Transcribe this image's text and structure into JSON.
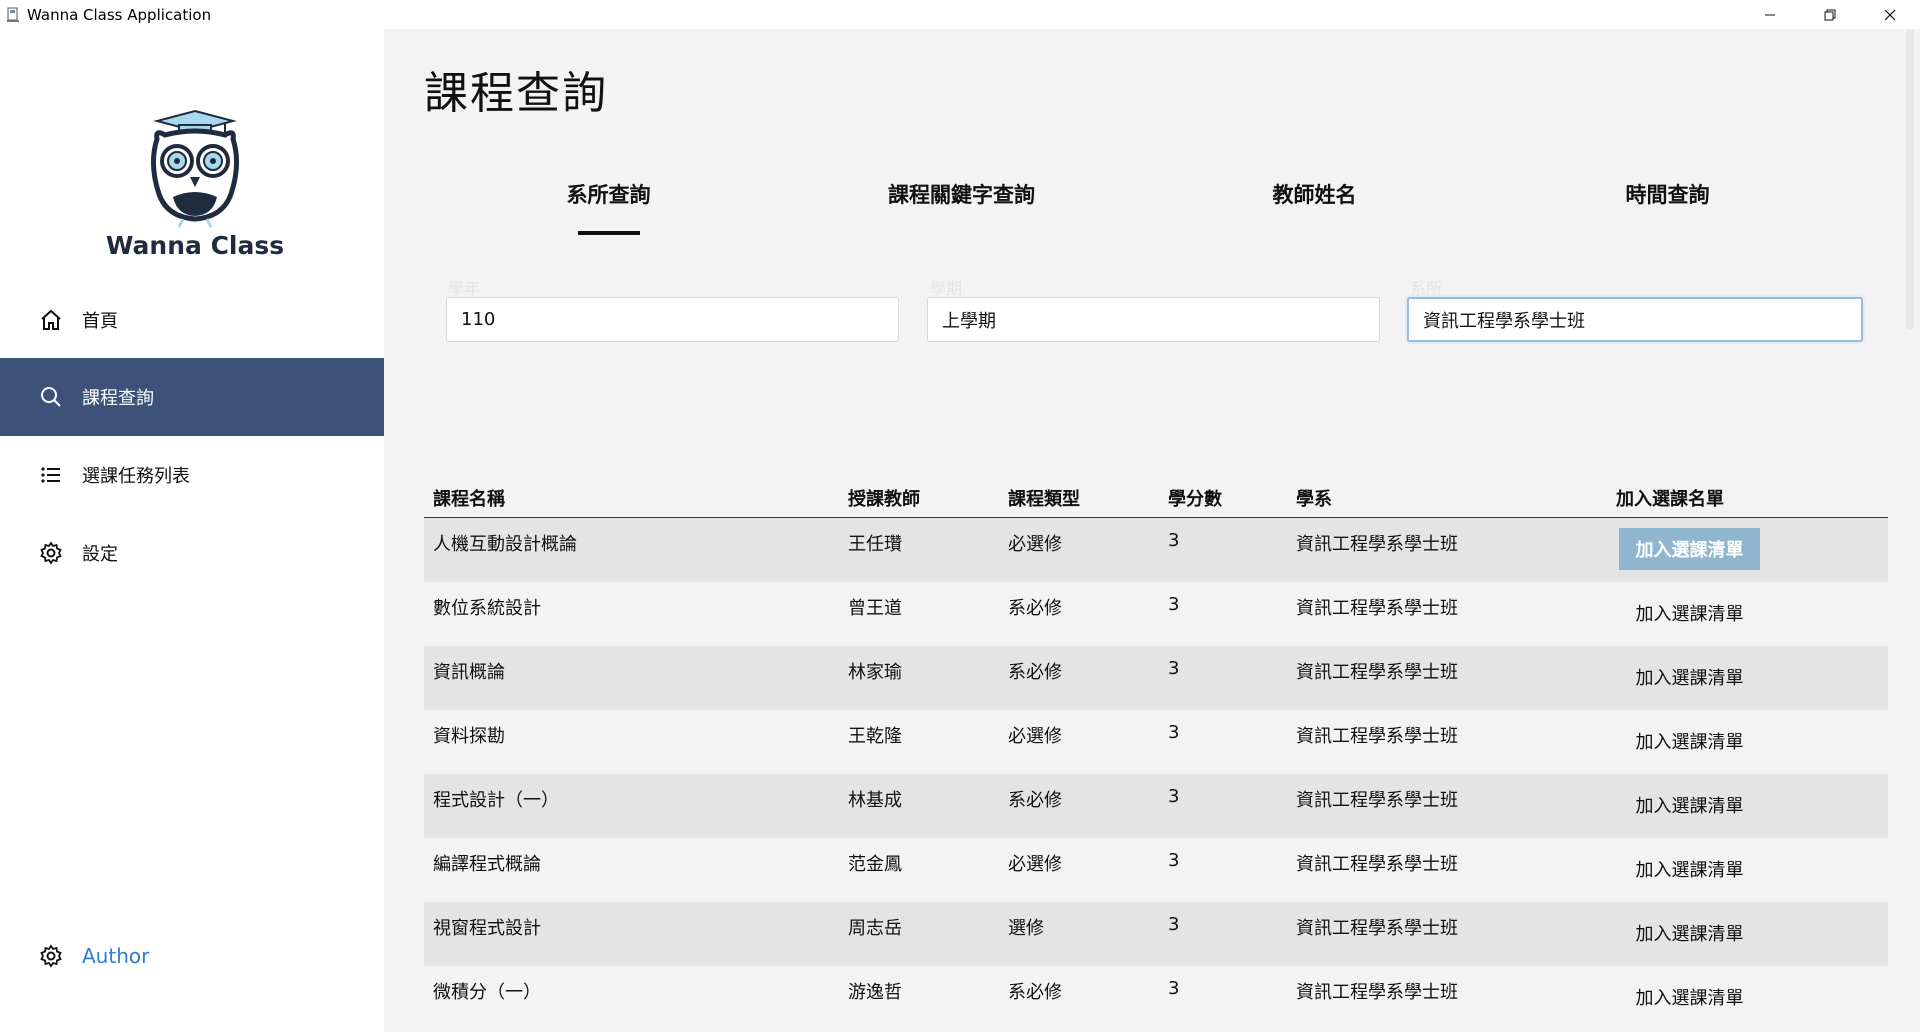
{
  "window": {
    "title": "Wanna Class Application"
  },
  "sidebar": {
    "logo_text": "Wanna Class",
    "items": [
      {
        "label": "首頁",
        "icon": "home-icon"
      },
      {
        "label": "課程查詢",
        "icon": "search-icon"
      },
      {
        "label": "選課任務列表",
        "icon": "list-icon"
      },
      {
        "label": "設定",
        "icon": "gear-icon"
      }
    ],
    "author_label": "Author"
  },
  "main": {
    "title": "課程查詢",
    "tabs": [
      "系所查詢",
      "課程關鍵字查詢",
      "教師姓名",
      "時間查詢"
    ],
    "active_tab": "系所查詢",
    "filters": {
      "year": {
        "label": "學年",
        "value": "110"
      },
      "semester": {
        "label": "學期",
        "value": "上學期"
      },
      "department": {
        "label": "系所",
        "value": "資訊工程學系學士班"
      }
    },
    "table": {
      "headers": [
        "課程名稱",
        "授課教師",
        "課程類型",
        "學分數",
        "學系",
        "加入選課名單"
      ],
      "rows": [
        {
          "name": "人機互動設計概論",
          "teacher": "王任瓚",
          "type": "必選修",
          "credits": "3",
          "dept": "資訊工程學系學士班",
          "action": "加入選課清單"
        },
        {
          "name": "數位系統設計",
          "teacher": "曾王道",
          "type": "系必修",
          "credits": "3",
          "dept": "資訊工程學系學士班",
          "action": "加入選課清單"
        },
        {
          "name": "資訊概論",
          "teacher": "林家瑜",
          "type": "系必修",
          "credits": "3",
          "dept": "資訊工程學系學士班",
          "action": "加入選課清單"
        },
        {
          "name": "資料探勘",
          "teacher": "王乾隆",
          "type": "必選修",
          "credits": "3",
          "dept": "資訊工程學系學士班",
          "action": "加入選課清單"
        },
        {
          "name": "程式設計（一）",
          "teacher": "林基成",
          "type": "系必修",
          "credits": "3",
          "dept": "資訊工程學系學士班",
          "action": "加入選課清單"
        },
        {
          "name": "編譯程式概論",
          "teacher": "范金鳳",
          "type": "必選修",
          "credits": "3",
          "dept": "資訊工程學系學士班",
          "action": "加入選課清單"
        },
        {
          "name": "視窗程式設計",
          "teacher": "周志岳",
          "type": "選修",
          "credits": "3",
          "dept": "資訊工程學系學士班",
          "action": "加入選課清單"
        },
        {
          "name": "微積分（一）",
          "teacher": "游逸哲",
          "type": "系必修",
          "credits": "3",
          "dept": "資訊工程學系學士班",
          "action": "加入選課清單"
        }
      ]
    }
  },
  "colors": {
    "sidebar_active": "#3d5279",
    "main_bg": "#f3f3f3",
    "button_highlight": "#8fb5cf",
    "author_link": "#2e7bd6"
  }
}
